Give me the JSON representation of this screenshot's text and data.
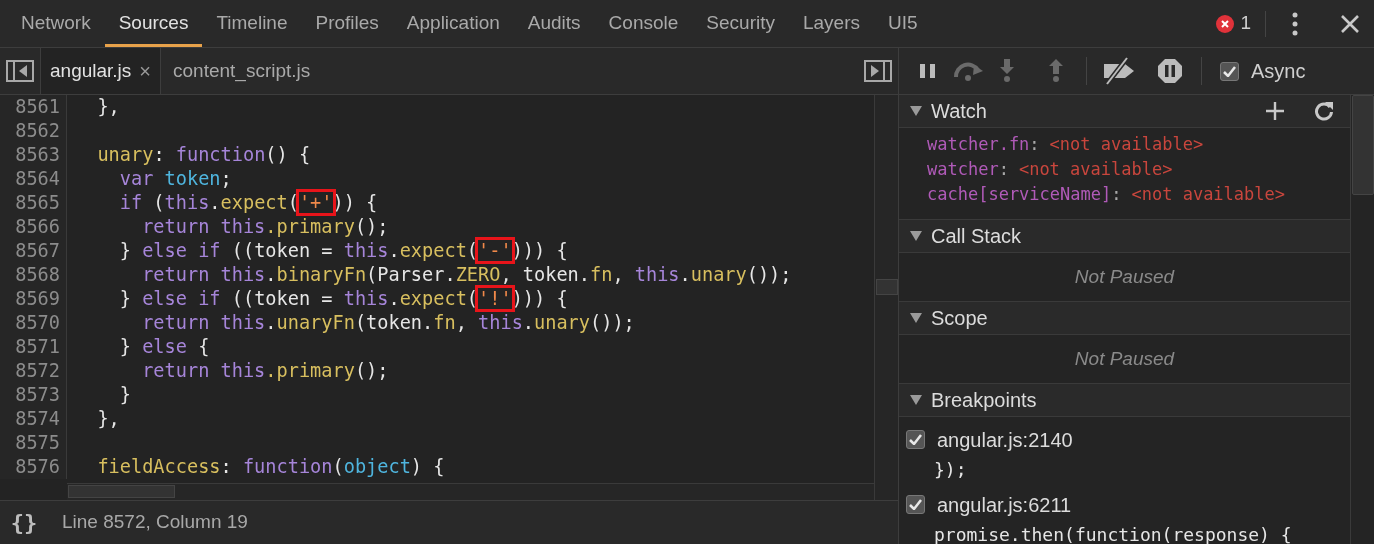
{
  "main_tabs": [
    {
      "label": "Network",
      "selected": false
    },
    {
      "label": "Sources",
      "selected": true
    },
    {
      "label": "Timeline",
      "selected": false
    },
    {
      "label": "Profiles",
      "selected": false
    },
    {
      "label": "Application",
      "selected": false
    },
    {
      "label": "Audits",
      "selected": false
    },
    {
      "label": "Console",
      "selected": false
    },
    {
      "label": "Security",
      "selected": false
    },
    {
      "label": "Layers",
      "selected": false
    },
    {
      "label": "UI5",
      "selected": false
    }
  ],
  "error_count": "1",
  "file_tabs": [
    {
      "label": "angular.js",
      "selected": true,
      "close": "×"
    },
    {
      "label": "content_script.js",
      "selected": false
    }
  ],
  "code_lines": [
    {
      "number": "8561",
      "tokens": [
        {
          "text": "  },",
          "kind": "plain"
        }
      ]
    },
    {
      "number": "8562"
    },
    {
      "number": "8563",
      "tokens": [
        {
          "text": "  unary",
          "kind": "property"
        },
        {
          "text": ": ",
          "kind": "plain"
        },
        {
          "text": "function",
          "kind": "keyword"
        },
        {
          "text": "() {",
          "kind": "plain"
        }
      ]
    },
    {
      "number": "8564",
      "tokens": [
        {
          "text": "    var",
          "kind": "keyword"
        },
        {
          "text": " token",
          "kind": "variable"
        },
        {
          "text": ";",
          "kind": "plain"
        }
      ]
    },
    {
      "number": "8565",
      "tokens": [
        {
          "text": "    if",
          "kind": "keyword"
        },
        {
          "text": " (",
          "kind": "plain"
        },
        {
          "text": "this",
          "kind": "keyword"
        },
        {
          "text": ".",
          "kind": "plain"
        },
        {
          "text": "expect",
          "kind": "property"
        },
        {
          "text": "(",
          "kind": "plain"
        },
        {
          "text": "'+'",
          "kind": "string",
          "marked": true
        },
        {
          "text": ")) {",
          "kind": "plain"
        }
      ]
    },
    {
      "number": "8566",
      "tokens": [
        {
          "text": "      return this",
          "kind": "keyword"
        },
        {
          "text": ".primary",
          "kind": "property"
        },
        {
          "text": "();",
          "kind": "plain"
        }
      ]
    },
    {
      "number": "8567",
      "tokens": [
        {
          "text": "    } ",
          "kind": "plain"
        },
        {
          "text": "else if",
          "kind": "keyword"
        },
        {
          "text": " ((token = ",
          "kind": "plain"
        },
        {
          "text": "this",
          "kind": "keyword"
        },
        {
          "text": ".",
          "kind": "plain"
        },
        {
          "text": "expect",
          "kind": "property"
        },
        {
          "text": "(",
          "kind": "plain"
        },
        {
          "text": "'-'",
          "kind": "string",
          "marked": true
        },
        {
          "text": "))) {",
          "kind": "plain"
        }
      ]
    },
    {
      "number": "8568",
      "tokens": [
        {
          "text": "      return this",
          "kind": "keyword"
        },
        {
          "text": ".",
          "kind": "plain"
        },
        {
          "text": "binaryFn",
          "kind": "property"
        },
        {
          "text": "(Parser.",
          "kind": "plain"
        },
        {
          "text": "ZERO",
          "kind": "property"
        },
        {
          "text": ", token.",
          "kind": "plain"
        },
        {
          "text": "fn",
          "kind": "property"
        },
        {
          "text": ", ",
          "kind": "plain"
        },
        {
          "text": "this",
          "kind": "keyword"
        },
        {
          "text": ".",
          "kind": "plain"
        },
        {
          "text": "unary",
          "kind": "property"
        },
        {
          "text": "());",
          "kind": "plain"
        }
      ]
    },
    {
      "number": "8569",
      "tokens": [
        {
          "text": "    } ",
          "kind": "plain"
        },
        {
          "text": "else if",
          "kind": "keyword"
        },
        {
          "text": " ((token = ",
          "kind": "plain"
        },
        {
          "text": "this",
          "kind": "keyword"
        },
        {
          "text": ".",
          "kind": "plain"
        },
        {
          "text": "expect",
          "kind": "property"
        },
        {
          "text": "(",
          "kind": "plain"
        },
        {
          "text": "'!'",
          "kind": "string",
          "marked": true
        },
        {
          "text": "))) {",
          "kind": "plain"
        }
      ]
    },
    {
      "number": "8570",
      "tokens": [
        {
          "text": "      return this",
          "kind": "keyword"
        },
        {
          "text": ".",
          "kind": "plain"
        },
        {
          "text": "unaryFn",
          "kind": "property"
        },
        {
          "text": "(token.",
          "kind": "plain"
        },
        {
          "text": "fn",
          "kind": "property"
        },
        {
          "text": ", ",
          "kind": "plain"
        },
        {
          "text": "this",
          "kind": "keyword"
        },
        {
          "text": ".",
          "kind": "plain"
        },
        {
          "text": "unary",
          "kind": "property"
        },
        {
          "text": "());",
          "kind": "plain"
        }
      ]
    },
    {
      "number": "8571",
      "tokens": [
        {
          "text": "    } ",
          "kind": "plain"
        },
        {
          "text": "else",
          "kind": "keyword"
        },
        {
          "text": " {",
          "kind": "plain"
        }
      ]
    },
    {
      "number": "8572",
      "tokens": [
        {
          "text": "      return this",
          "kind": "keyword"
        },
        {
          "text": ".primary",
          "kind": "property"
        },
        {
          "text": "();",
          "kind": "plain"
        }
      ]
    },
    {
      "number": "8573",
      "tokens": [
        {
          "text": "    }",
          "kind": "plain"
        }
      ]
    },
    {
      "number": "8574",
      "tokens": [
        {
          "text": "  },",
          "kind": "plain"
        }
      ]
    },
    {
      "number": "8575"
    },
    {
      "number": "8576",
      "tokens": [
        {
          "text": "  fieldAccess",
          "kind": "property"
        },
        {
          "text": ": ",
          "kind": "plain"
        },
        {
          "text": "function",
          "kind": "keyword"
        },
        {
          "text": "(",
          "kind": "plain"
        },
        {
          "text": "object",
          "kind": "variable"
        },
        {
          "text": ") {",
          "kind": "plain"
        }
      ]
    }
  ],
  "status_bar": {
    "format_icon": "{}",
    "position": "Line 8572, Column 19"
  },
  "debugger": {
    "async": {
      "label": "Async",
      "checked": true
    },
    "sections": [
      {
        "kind": "watch",
        "title": "Watch",
        "expanded": true,
        "items": [
          {
            "name": "watcher.fn",
            "separator": ":",
            "value": "<not available>"
          },
          {
            "name": "watcher",
            "separator": ":",
            "value": "<not available>"
          },
          {
            "name": "cache[serviceName]",
            "separator": ":",
            "value": "<not available>"
          }
        ]
      },
      {
        "kind": "message",
        "title": "Call Stack",
        "expanded": true,
        "message": "Not Paused"
      },
      {
        "kind": "message",
        "title": "Scope",
        "expanded": true,
        "message": "Not Paused"
      },
      {
        "kind": "breakpoints",
        "title": "Breakpoints",
        "expanded": true,
        "items": [
          {
            "location": "angular.js:2140",
            "code": "});",
            "checked": true
          },
          {
            "location": "angular.js:6211",
            "code": "promise.then(function(response) {",
            "checked": true
          }
        ]
      }
    ]
  }
}
